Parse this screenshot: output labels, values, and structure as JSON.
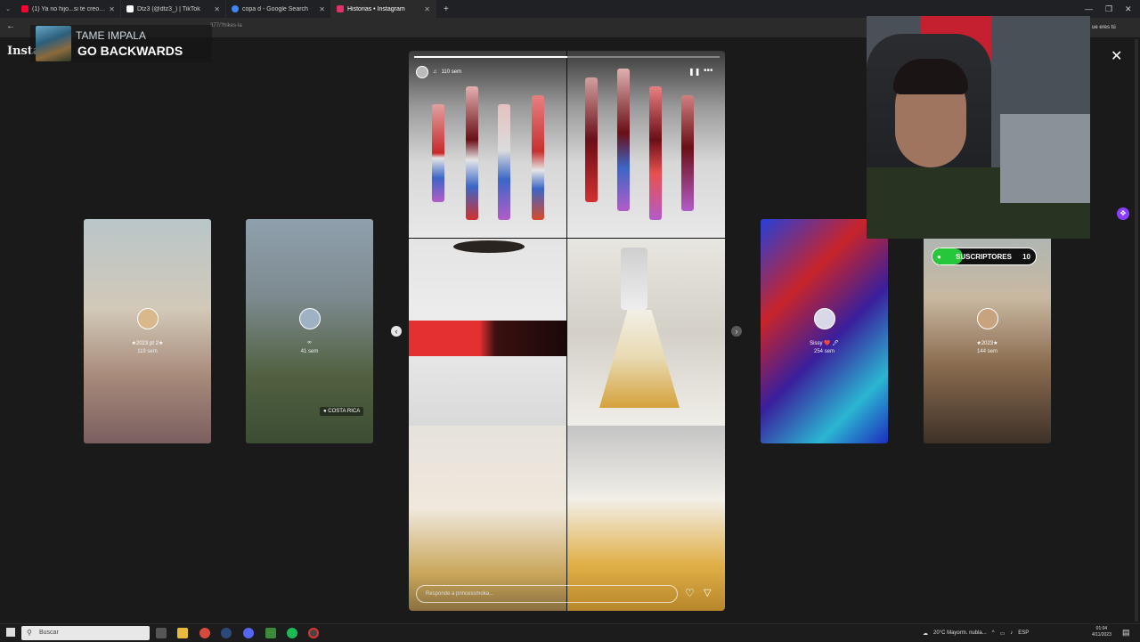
{
  "browser": {
    "tabs": [
      {
        "label": "(1) Ya no hijo...si te creo hijo | C",
        "icon_color": "#ff0033"
      },
      {
        "label": "Dtz3 (@dtz3_) | TikTok",
        "icon_color": "#111111"
      },
      {
        "label": "copa d - Google Search",
        "icon_color": "#4285f4"
      },
      {
        "label": "Historias • Instagram",
        "icon_color": "#e1306c"
      }
    ],
    "new_tab": "+",
    "url": "377/?hikes-la",
    "right_text": "ue eres tú"
  },
  "instagram": {
    "logo": "Insta",
    "close": "✕"
  },
  "music": {
    "artist": "TAME IMPALA",
    "song": "GO BACKWARDS"
  },
  "stories": [
    {
      "name": "★2023 pt 2★",
      "age": "119 sem"
    },
    {
      "name": "∞",
      "age": "41 sem",
      "location": "COSTA RICA"
    },
    {
      "name": "Sissy ❤️ 🖊",
      "age": "254 sem"
    },
    {
      "name": "★2023★",
      "age": "144 sem"
    }
  ],
  "main_story": {
    "time": "110 sem",
    "reply_placeholder": "Responde a princessmoka...",
    "progress": 0.5
  },
  "subscribers": {
    "label": "SUSCRIPTORES",
    "count": "10"
  },
  "taskbar": {
    "search": "Buscar",
    "weather": "20°C  Mayorm. nubla...",
    "lang": "ESP",
    "time": "01:04",
    "date": "4/11/2023"
  },
  "colors": {
    "accent_green": "#27c73b",
    "purple": "#8b3dff"
  }
}
